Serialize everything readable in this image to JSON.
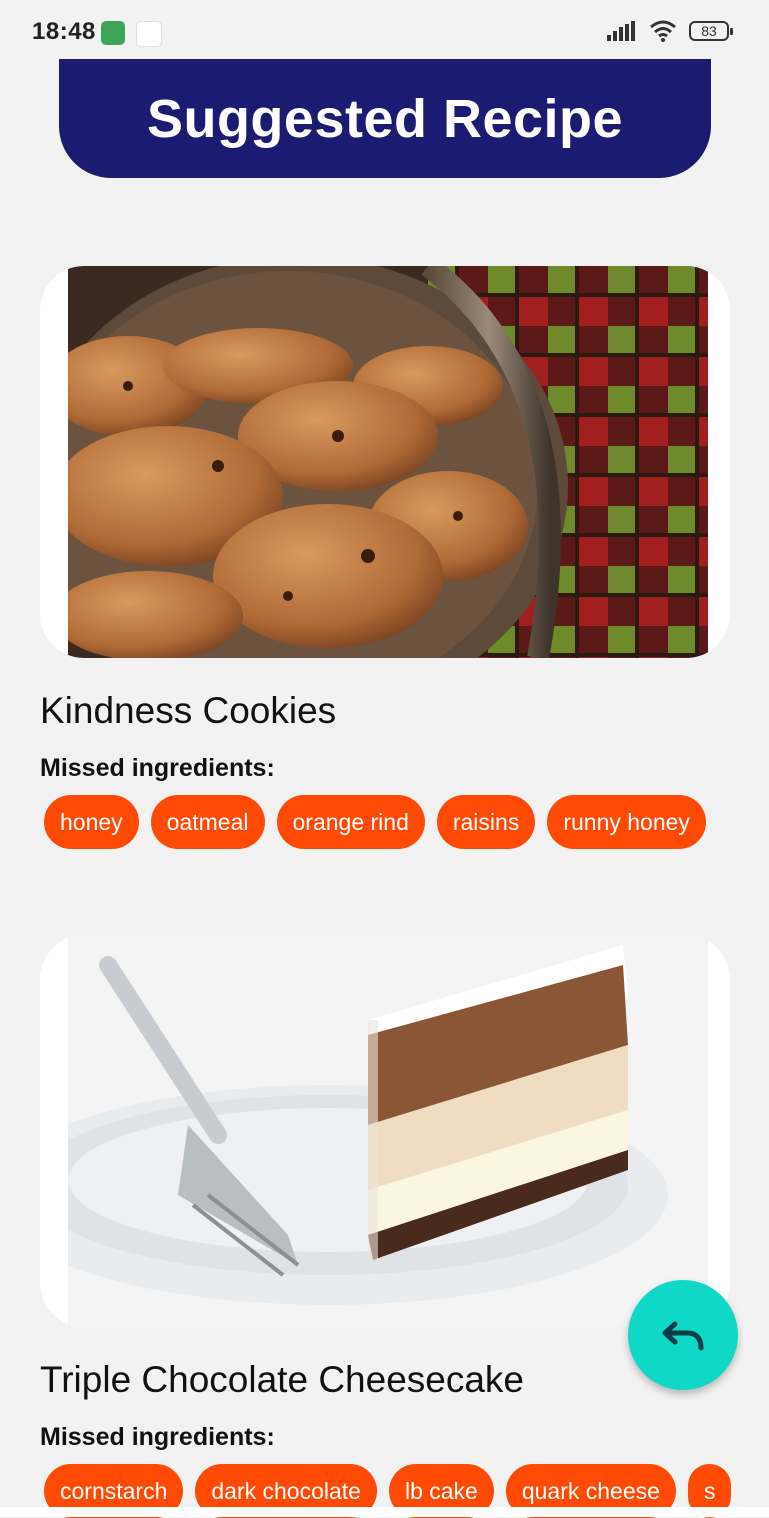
{
  "status_bar": {
    "time": "18:48",
    "battery": "83"
  },
  "header": {
    "title": "Suggested Recipe"
  },
  "recipes": [
    {
      "title": "Kindness Cookies",
      "missed_label": "Missed ingredients:",
      "ingredients": [
        "honey",
        "oatmeal",
        "orange rind",
        "raisins",
        "runny honey"
      ]
    },
    {
      "title": "Triple Chocolate Cheesecake",
      "missed_label": "Missed ingredients:",
      "ingredients": [
        "cornstarch",
        "dark chocolate",
        "lb cake",
        "quark cheese",
        "s"
      ]
    }
  ],
  "fab": {
    "icon": "undo-icon"
  },
  "colors": {
    "header_bg": "#1b1b72",
    "chip_bg": "#ff4a05",
    "fab_bg": "#0fd8c6",
    "page_bg": "#f2f2f3"
  }
}
